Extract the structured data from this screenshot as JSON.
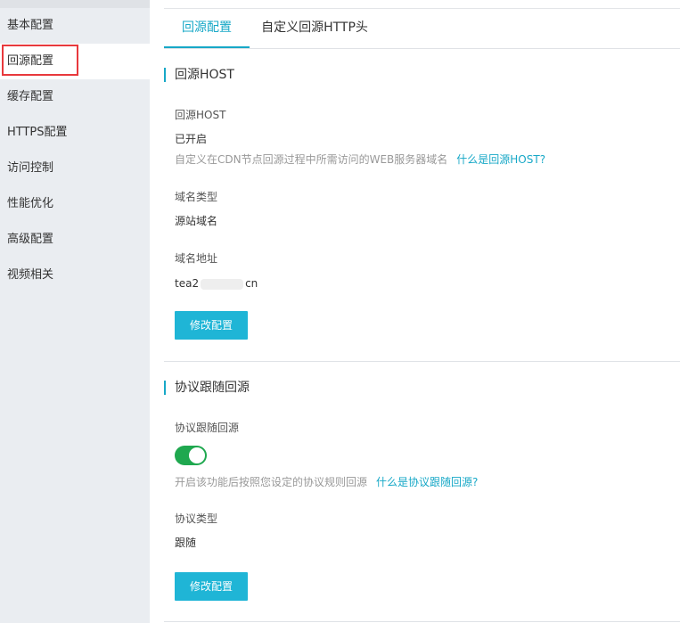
{
  "sidebar": {
    "items": [
      {
        "label": "基本配置"
      },
      {
        "label": "回源配置"
      },
      {
        "label": "缓存配置"
      },
      {
        "label": "HTTPS配置"
      },
      {
        "label": "访问控制"
      },
      {
        "label": "性能优化"
      },
      {
        "label": "高级配置"
      },
      {
        "label": "视频相关"
      }
    ],
    "active_index": 1
  },
  "tabs": [
    {
      "label": "回源配置"
    },
    {
      "label": "自定义回源HTTP头"
    }
  ],
  "host_section": {
    "title": "回源HOST",
    "host_label": "回源HOST",
    "host_value": "已开启",
    "host_desc": "自定义在CDN节点回源过程中所需访问的WEB服务器域名",
    "host_help": "什么是回源HOST?",
    "domain_type_label": "域名类型",
    "domain_type_value": "源站域名",
    "domain_addr_label": "域名地址",
    "domain_addr_prefix": "tea2",
    "domain_addr_suffix": "cn",
    "modify_button": "修改配置"
  },
  "protocol_section": {
    "title": "协议跟随回源",
    "follow_label": "协议跟随回源",
    "follow_enabled": true,
    "follow_desc": "开启该功能后按照您设定的协议规则回源",
    "follow_help": "什么是协议跟随回源?",
    "protocol_type_label": "协议类型",
    "protocol_type_value": "跟随",
    "modify_button": "修改配置"
  },
  "colors": {
    "accent": "#17a8c7",
    "button": "#1fb5d6",
    "toggle_on": "#1fa84f",
    "highlight": "#e8393d",
    "sidebar_bg": "#eaedf1"
  }
}
